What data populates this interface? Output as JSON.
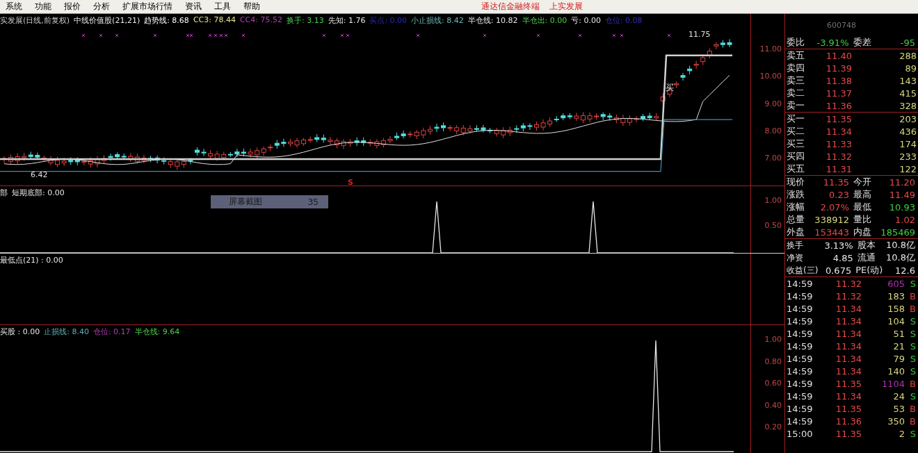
{
  "menu": {
    "items": [
      "系统",
      "功能",
      "报价",
      "分析",
      "扩展市场行情",
      "资讯",
      "工具",
      "帮助"
    ],
    "titles": [
      "通达信金融终端",
      "上实发展"
    ]
  },
  "main_pane": {
    "legend": [
      {
        "text": "实发展(日线,前复权)",
        "color": "#c8c8c8"
      },
      {
        "text": "中线价值股(21,21)",
        "color": "#e8e8e8"
      },
      {
        "text": "趋势线: 8.68",
        "color": "#ffffff"
      },
      {
        "text": "CC3: 78.44",
        "color": "#e6e68c"
      },
      {
        "text": "CC4: 75.52",
        "color": "#b040b0"
      },
      {
        "text": "换手: 3.13",
        "color": "#50d050"
      },
      {
        "text": "先知: 1.76",
        "color": "#e8e8e8"
      },
      {
        "text": "买点: 0.00",
        "color": "#2828c8"
      },
      {
        "text": "小止损线: 8.42",
        "color": "#70b8b8"
      },
      {
        "text": "半仓线: 10.82",
        "color": "#e8e8e8"
      },
      {
        "text": "半仓出: 0.00",
        "color": "#50d050"
      },
      {
        "text": "亏: 0.00",
        "color": "#e8e8e8"
      },
      {
        "text": "仓位: 0.08",
        "color": "#3030c0"
      }
    ],
    "high_label": "11.75",
    "low_label": "6.42",
    "buy_marker": "买",
    "sell_marker": "S",
    "yticks": [
      "11.00",
      "10.00",
      "9.00",
      "8.00",
      "7.00"
    ]
  },
  "pane_2": {
    "legend": [
      "部",
      "短期底部: 0.00"
    ],
    "yticks": [
      "1.00",
      "0.50"
    ],
    "tooltip": {
      "label": "屏幕截图",
      "value": "35"
    }
  },
  "pane_3": {
    "legend": [
      "最低点(21) : 0.00"
    ]
  },
  "pane_4": {
    "legend": [
      {
        "text": "买股 : 0.00",
        "color": "#e8e8e8"
      },
      {
        "text": "止损线: 8.40",
        "color": "#60b0b0"
      },
      {
        "text": "仓位: 0.17",
        "color": "#b040b0"
      },
      {
        "text": "半仓线: 9.64",
        "color": "#50d050"
      }
    ],
    "yticks": [
      "1.00",
      "0.80",
      "0.60",
      "0.40",
      "0.20"
    ]
  },
  "quote_panel": {
    "code": "600748",
    "ratio": {
      "label": "委比",
      "value": "-3.91%",
      "diff_label": "委差",
      "diff": "-95"
    },
    "asks": [
      {
        "label": "卖五",
        "price": "11.40",
        "volume": "288"
      },
      {
        "label": "卖四",
        "price": "11.39",
        "volume": "89"
      },
      {
        "label": "卖三",
        "price": "11.38",
        "volume": "143"
      },
      {
        "label": "卖二",
        "price": "11.37",
        "volume": "415"
      },
      {
        "label": "卖一",
        "price": "11.36",
        "volume": "328"
      }
    ],
    "bids": [
      {
        "label": "买一",
        "price": "11.35",
        "volume": "203"
      },
      {
        "label": "买二",
        "price": "11.34",
        "volume": "436"
      },
      {
        "label": "买三",
        "price": "11.33",
        "volume": "174"
      },
      {
        "label": "买四",
        "price": "11.32",
        "volume": "233"
      },
      {
        "label": "买五",
        "price": "11.31",
        "volume": "122"
      }
    ],
    "quotes": [
      {
        "label": "现价",
        "value": "11.35",
        "color": "#e84848"
      },
      {
        "label": "今开",
        "value": "11.20",
        "color": "#e84848"
      },
      {
        "label": "涨跌",
        "value": "0.23",
        "color": "#e84848"
      },
      {
        "label": "最高",
        "value": "11.49",
        "color": "#e84848"
      },
      {
        "label": "涨幅",
        "value": "2.07%",
        "color": "#e84848"
      },
      {
        "label": "最低",
        "value": "10.93",
        "color": "#40d040"
      },
      {
        "label": "总量",
        "value": "338912",
        "color": "#d8d880"
      },
      {
        "label": "量比",
        "value": "1.02",
        "color": "#e84848"
      },
      {
        "label": "外盘",
        "value": "153443",
        "color": "#e84848"
      },
      {
        "label": "内盘",
        "value": "185469",
        "color": "#40d040"
      }
    ],
    "stats": [
      {
        "label": "换手",
        "value": "3.13%",
        "label2": "股本",
        "value2": "10.8亿"
      },
      {
        "label": "净资",
        "value": "4.85",
        "label2": "流通",
        "value2": "10.8亿"
      },
      {
        "label": "收益(三)",
        "value": "0.675",
        "label2": "PE(动)",
        "value2": "12.6"
      }
    ],
    "ticks": [
      {
        "time": "14:59",
        "price": "11.32",
        "volume": "605",
        "color": "#b030b0",
        "side": "S",
        "kind": "sell"
      },
      {
        "time": "14:59",
        "price": "11.32",
        "volume": "183",
        "color": "#d8d880",
        "side": "B",
        "kind": "buy"
      },
      {
        "time": "14:59",
        "price": "11.34",
        "volume": "158",
        "color": "#d8d880",
        "side": "B",
        "kind": "buy"
      },
      {
        "time": "14:59",
        "price": "11.34",
        "volume": "104",
        "color": "#d8d880",
        "side": "S",
        "kind": "sell"
      },
      {
        "time": "14:59",
        "price": "11.34",
        "volume": "51",
        "color": "#d8d880",
        "side": "S",
        "kind": "sell"
      },
      {
        "time": "14:59",
        "price": "11.34",
        "volume": "21",
        "color": "#d8d880",
        "side": "S",
        "kind": "sell"
      },
      {
        "time": "14:59",
        "price": "11.34",
        "volume": "79",
        "color": "#d8d880",
        "side": "S",
        "kind": "sell"
      },
      {
        "time": "14:59",
        "price": "11.34",
        "volume": "140",
        "color": "#d8d880",
        "side": "S",
        "kind": "sell"
      },
      {
        "time": "14:59",
        "price": "11.35",
        "volume": "1104",
        "color": "#b030b0",
        "side": "B",
        "kind": "buy"
      },
      {
        "time": "14:59",
        "price": "11.34",
        "volume": "24",
        "color": "#d8d880",
        "side": "S",
        "kind": "sell"
      },
      {
        "time": "14:59",
        "price": "11.35",
        "volume": "53",
        "color": "#d8d880",
        "side": "B",
        "kind": "buy"
      },
      {
        "time": "14:59",
        "price": "11.36",
        "volume": "350",
        "color": "#d8d880",
        "side": "B",
        "kind": "buy"
      },
      {
        "time": "15:00",
        "price": "11.35",
        "volume": "2",
        "color": "#d8d880",
        "side": "S",
        "kind": "sell"
      }
    ]
  }
}
